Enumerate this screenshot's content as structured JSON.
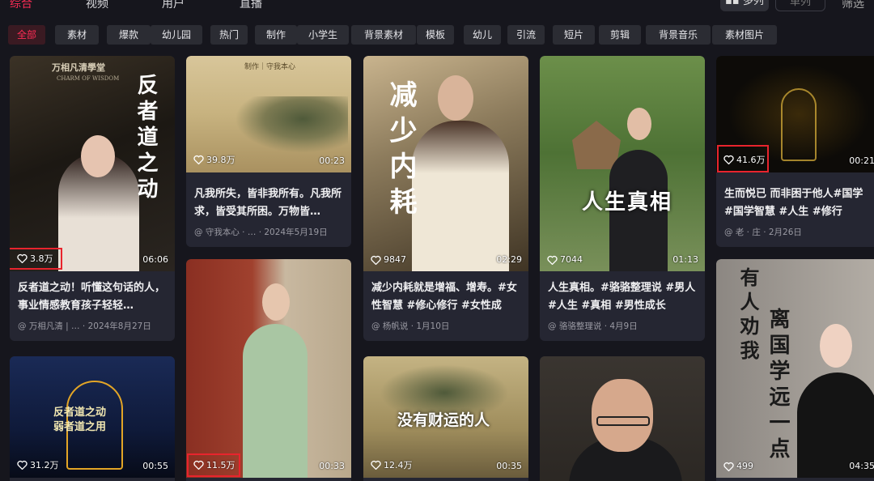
{
  "top_nav": {
    "tabs": [
      "综合",
      "视频",
      "用户",
      "直播"
    ],
    "right_buttons": [
      "多列",
      "单列"
    ],
    "filter_label": "筛选"
  },
  "chips": [
    "全部",
    "素材",
    "爆款",
    "幼儿园",
    "热门",
    "制作",
    "小学生",
    "背景素材",
    "模板",
    "幼儿",
    "引流",
    "短片",
    "剪辑",
    "背景音乐",
    "素材图片"
  ],
  "cards": [
    {
      "likes": "3.8万",
      "duration": "06:06",
      "caption": "反者道之动！听懂这句话的人，事业情感教育孩子轻轻…",
      "author": "@ 万相凡清 | …",
      "date": "· 2024年8月27日",
      "thumb_title": "反者道之动",
      "thumb_brand": "万相凡清學堂",
      "thumb_brand_en": "CHARM OF WISDOM"
    },
    {
      "likes": "39.8万",
      "duration": "00:23",
      "caption": "凡我所失，皆非我所有。凡我所求，皆受其所困。万物皆…",
      "author": "@ 守我本心 · …",
      "date": "· 2024年5月19日",
      "thumb_brand": "制作｜守我本心"
    },
    {
      "likes": "9847",
      "duration": "02:29",
      "caption": "减少内耗就是增福、增寿。#女性智慧 #修心修行 #女性成长…",
      "author": "@ 杨帆说",
      "date": "· 1月10日",
      "thumb_title": "减少内耗"
    },
    {
      "likes": "7044",
      "duration": "01:13",
      "caption": "人生真相。#骆骆整理说 #男人 #人生 #真相 #男性成长",
      "author": "@ 骆骆整理说",
      "date": "· 4月9日",
      "thumb_title": "人生真相"
    },
    {
      "likes": "41.6万",
      "duration": "00:21",
      "caption": "生而悦已 而非困于他人#国学 #国学智慧 #人生 #修行",
      "author": "@ 老 · 庄",
      "date": "· 2月26日"
    },
    {
      "likes": "31.2万",
      "duration": "00:55",
      "thumb_line1": "反者道之动",
      "thumb_line2": "弱者道之用"
    },
    {
      "likes": "11.5万",
      "duration": "00:33"
    },
    {
      "likes": "12.4万",
      "duration": "00:35",
      "thumb_title": "没有财运的人"
    },
    {
      "likes": "",
      "duration": ""
    },
    {
      "likes": "499",
      "duration": "04:35",
      "thumb_title_a": "有人劝我",
      "thumb_title_b": "离国学远一点"
    }
  ]
}
